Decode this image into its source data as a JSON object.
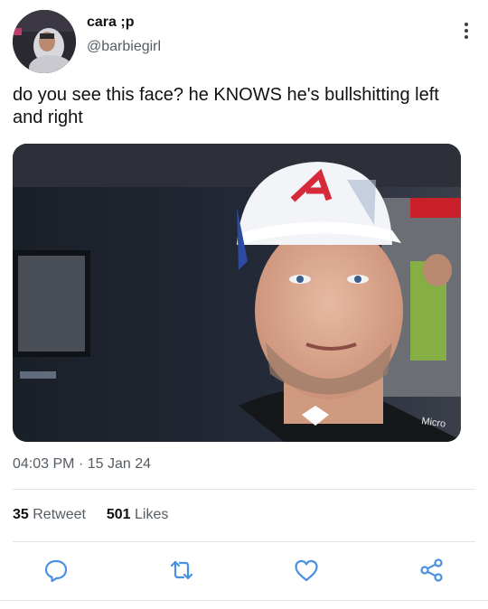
{
  "author": {
    "name": "cara ;p",
    "handle": "@barbiegirl"
  },
  "tweet": {
    "text": "do you see this face? he KNOWS he's bullshitting left and right"
  },
  "meta": {
    "time": "04:03 PM",
    "separator": "·",
    "date": "15 Jan 24"
  },
  "stats": {
    "retweets_count": "35",
    "retweets_label": "Retweet",
    "likes_count": "501",
    "likes_label": "Likes"
  },
  "icons": {
    "more": "more-vertical-icon",
    "reply": "reply-icon",
    "retweet": "retweet-icon",
    "like": "heart-icon",
    "share": "share-icon"
  },
  "colors": {
    "text": "#0f1419",
    "secondary": "#555c63",
    "divider": "#e1e5e8",
    "icon": "#4a90e2"
  }
}
